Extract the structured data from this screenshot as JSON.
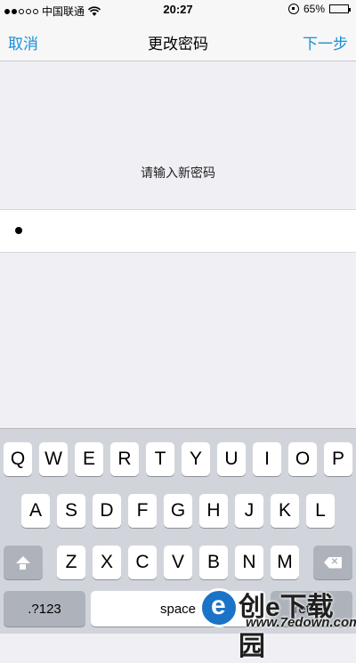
{
  "status_bar": {
    "carrier": "中国联通",
    "time": "20:27",
    "battery_percent": "65%",
    "signal_bars_filled": 2,
    "signal_bars_total": 5,
    "battery_level": 0.65
  },
  "nav": {
    "cancel_label": "取消",
    "title": "更改密码",
    "next_label": "下一步",
    "accent_color": "#1a8fd8"
  },
  "form": {
    "prompt": "请输入新密码",
    "masked_value": "•"
  },
  "keyboard": {
    "row1": [
      "Q",
      "W",
      "E",
      "R",
      "T",
      "Y",
      "U",
      "I",
      "O",
      "P"
    ],
    "row2": [
      "A",
      "S",
      "D",
      "F",
      "G",
      "H",
      "J",
      "K",
      "L"
    ],
    "row3": [
      "Z",
      "X",
      "C",
      "V",
      "B",
      "N",
      "M"
    ],
    "numbers_label": ".?123",
    "space_label": "space",
    "return_label": "return"
  },
  "watermark": {
    "text": "创e下载园",
    "url": "www.7edown.com"
  }
}
